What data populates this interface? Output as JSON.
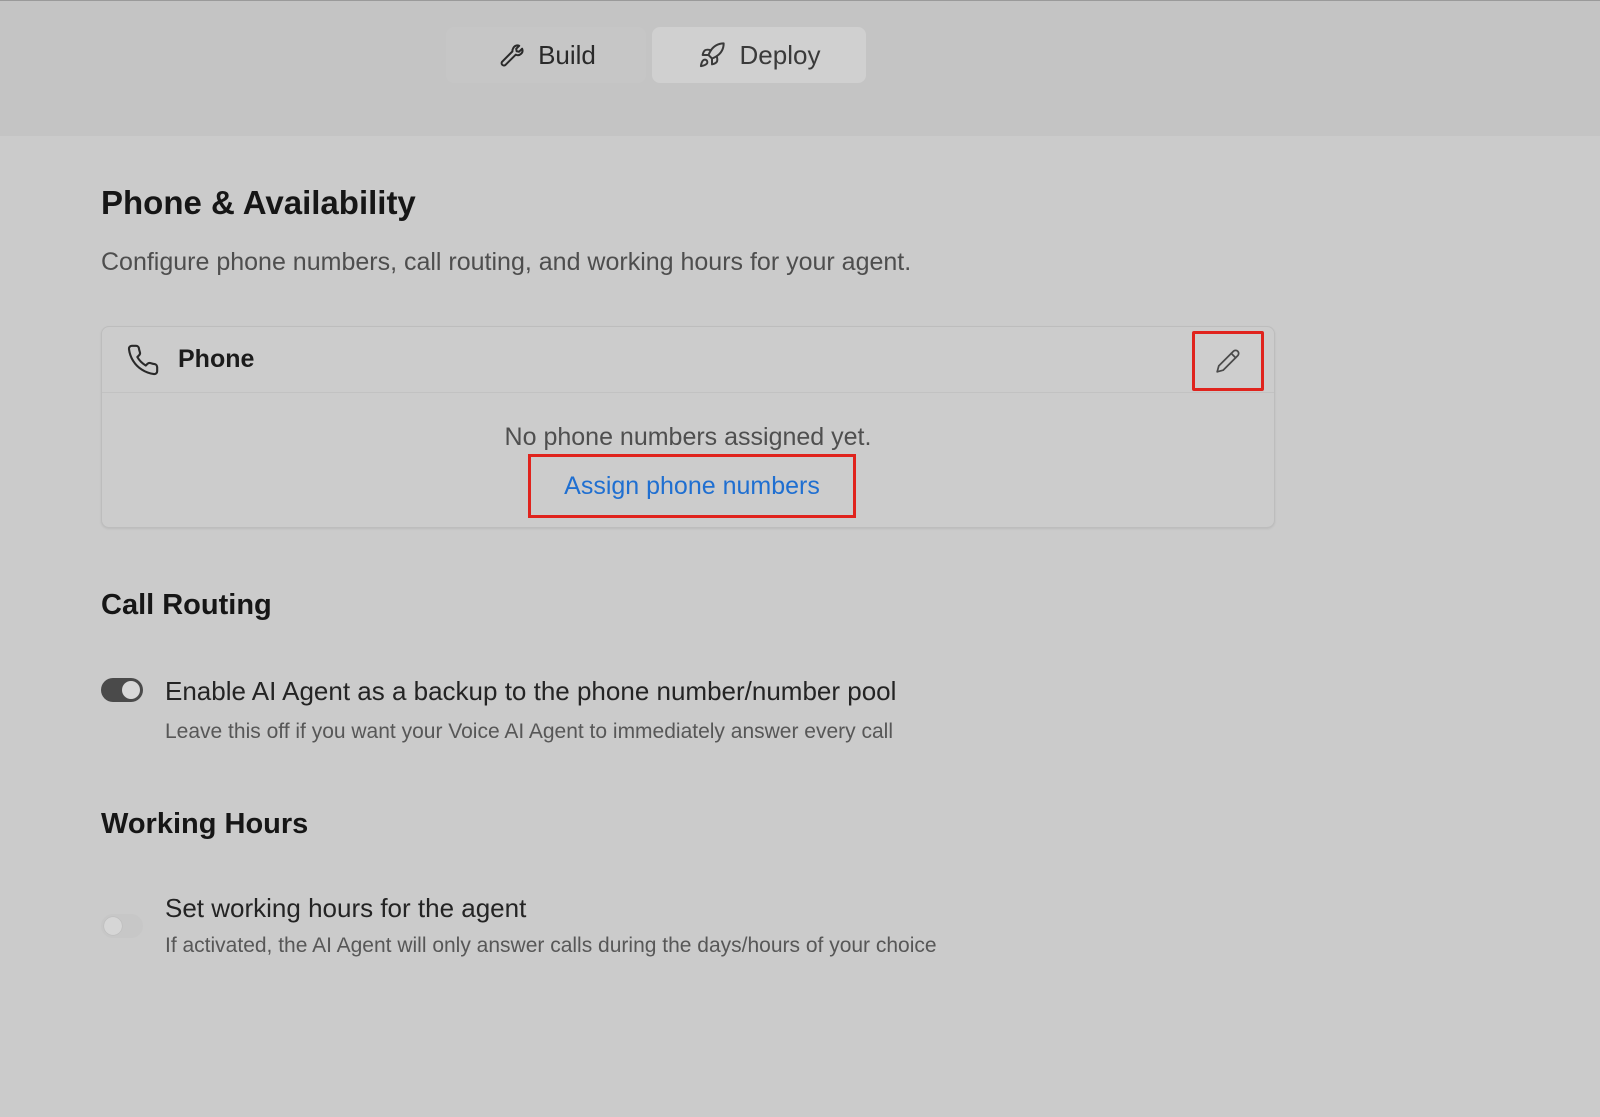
{
  "tabs": [
    {
      "label": "Build",
      "icon": "wrench-icon"
    },
    {
      "label": "Deploy",
      "icon": "rocket-icon"
    }
  ],
  "page": {
    "title": "Phone & Availability",
    "subtitle": "Configure phone numbers, call routing, and working hours for your agent."
  },
  "phone_card": {
    "title": "Phone",
    "empty_text": "No phone numbers assigned yet.",
    "assign_link": "Assign phone numbers"
  },
  "call_routing": {
    "title": "Call Routing",
    "option_label": "Enable AI Agent as a backup to the phone number/number pool",
    "option_desc": "Leave this off if you want your Voice AI Agent to immediately answer every call",
    "enabled": true
  },
  "working_hours": {
    "title": "Working Hours",
    "option_label": "Set working hours for the agent",
    "option_desc": "If activated, the AI Agent will only answer calls during the days/hours of your choice",
    "enabled": false
  },
  "colors": {
    "highlight": "#e0231d",
    "link": "#1f6fd1"
  }
}
